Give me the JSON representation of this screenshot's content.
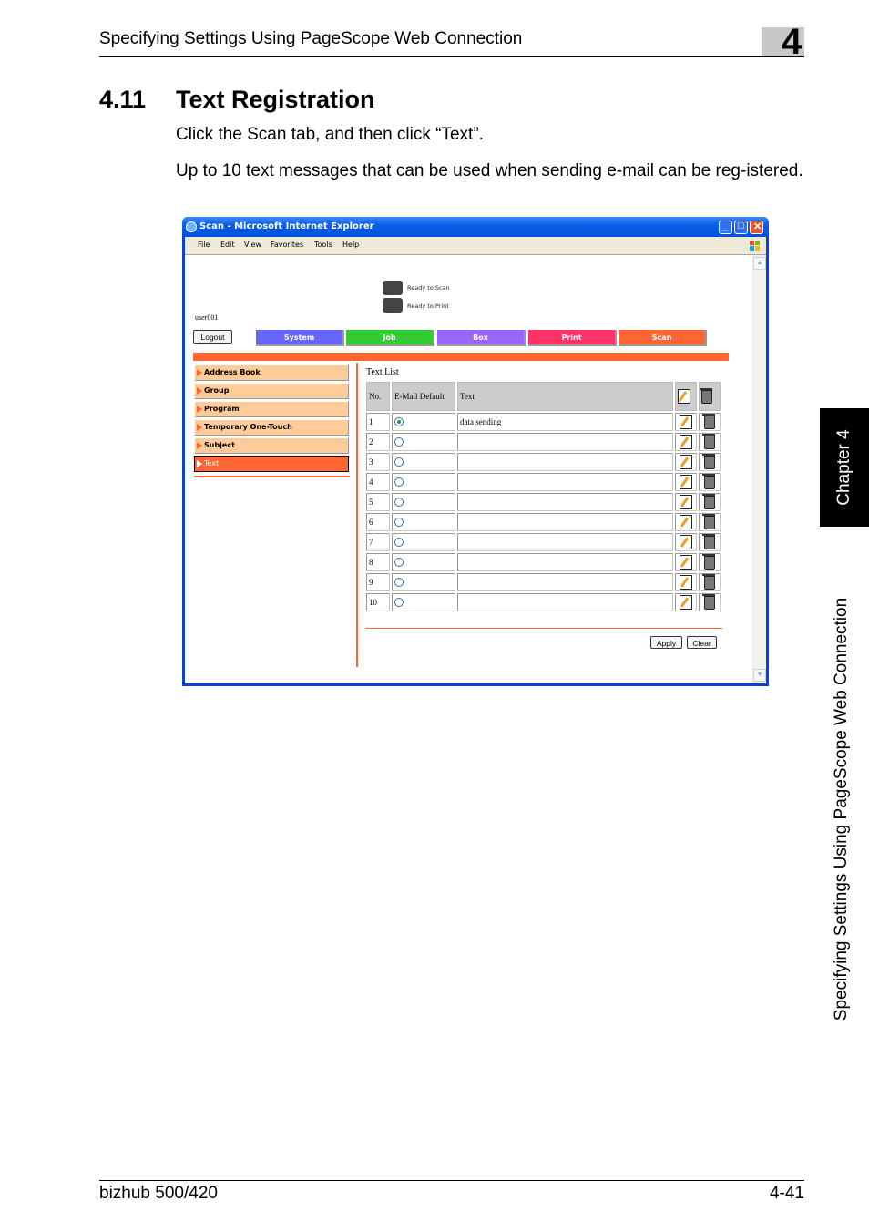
{
  "header": {
    "running_title": "Specifying Settings Using PageScope Web Connection",
    "chapter_number": "4"
  },
  "section": {
    "number": "4.11",
    "title": "Text Registration",
    "paragraphs": [
      "Click the Scan tab, and then click “Text”.",
      "Up to 10 text messages that can be used when sending e-mail can be reg-istered."
    ]
  },
  "side_tab": {
    "chapter": "Chapter 4",
    "title": "Specifying Settings Using PageScope Web Connection"
  },
  "footer": {
    "product": "bizhub 500/420",
    "page": "4-41"
  },
  "browser": {
    "window_title": "Scan - Microsoft Internet Explorer",
    "menu": [
      "File",
      "Edit",
      "View",
      "Favorites",
      "Tools",
      "Help"
    ],
    "status": {
      "scan": "Ready to Scan",
      "print": "Ready to Print"
    },
    "user": "user001",
    "logout_label": "Logout",
    "tabs": [
      {
        "label": "System",
        "color": "#6666ff"
      },
      {
        "label": "Job",
        "color": "#33cc33"
      },
      {
        "label": "Box",
        "color": "#9966ff"
      },
      {
        "label": "Print",
        "color": "#ff3366"
      },
      {
        "label": "Scan",
        "color": "#ff6633"
      }
    ],
    "left_menu": [
      {
        "label": "Address Book",
        "active": false
      },
      {
        "label": "Group",
        "active": false
      },
      {
        "label": "Program",
        "active": false
      },
      {
        "label": "Temporary One-Touch",
        "active": false
      },
      {
        "label": "Subject",
        "active": false
      },
      {
        "label": "Text",
        "active": true
      }
    ],
    "text_list": {
      "title": "Text List",
      "columns": {
        "no": "No.",
        "email_default": "E-Mail Default",
        "text": "Text"
      },
      "rows": [
        {
          "no": "1",
          "default": true,
          "text": "data sending"
        },
        {
          "no": "2",
          "default": false,
          "text": ""
        },
        {
          "no": "3",
          "default": false,
          "text": ""
        },
        {
          "no": "4",
          "default": false,
          "text": ""
        },
        {
          "no": "5",
          "default": false,
          "text": ""
        },
        {
          "no": "6",
          "default": false,
          "text": ""
        },
        {
          "no": "7",
          "default": false,
          "text": ""
        },
        {
          "no": "8",
          "default": false,
          "text": ""
        },
        {
          "no": "9",
          "default": false,
          "text": ""
        },
        {
          "no": "10",
          "default": false,
          "text": ""
        }
      ]
    },
    "apply_label": "Apply",
    "clear_label": "Clear"
  }
}
